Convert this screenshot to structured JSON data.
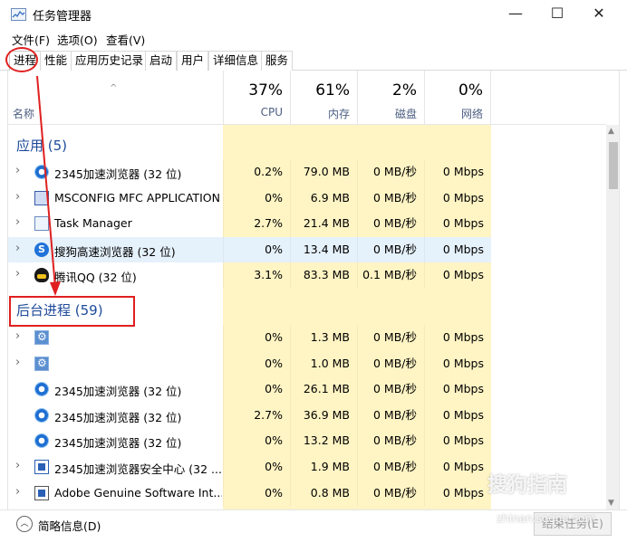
{
  "window": {
    "title": "任务管理器",
    "min": "—",
    "max": "☐",
    "close": "✕"
  },
  "menu": [
    "文件(F)",
    "选项(O)",
    "查看(V)"
  ],
  "tabs": [
    "进程",
    "性能",
    "应用历史记录",
    "启动",
    "用户",
    "详细信息",
    "服务"
  ],
  "header": {
    "name_label": "名称",
    "sort_caret": "^",
    "columns": [
      {
        "pct": "37%",
        "label": "CPU"
      },
      {
        "pct": "61%",
        "label": "内存"
      },
      {
        "pct": "2%",
        "label": "磁盘"
      },
      {
        "pct": "0%",
        "label": "网络"
      }
    ]
  },
  "groups": {
    "apps": "应用 (5)",
    "background": "后台进程 (59)"
  },
  "app_rows": [
    {
      "name": "2345加速浏览器 (32 位)",
      "icon": "globe-icon",
      "cpu": "0.2%",
      "mem": "79.0 MB",
      "disk": "0 MB/秒",
      "net": "0 Mbps"
    },
    {
      "name": "MSCONFIG MFC APPLICATION",
      "icon": "monitor-icon",
      "cpu": "0%",
      "mem": "6.9 MB",
      "disk": "0 MB/秒",
      "net": "0 Mbps"
    },
    {
      "name": "Task Manager",
      "icon": "task-manager-icon",
      "cpu": "2.7%",
      "mem": "21.4 MB",
      "disk": "0 MB/秒",
      "net": "0 Mbps"
    },
    {
      "name": "搜狗高速浏览器 (32 位)",
      "icon": "sogou-icon",
      "cpu": "0%",
      "mem": "13.4 MB",
      "disk": "0 MB/秒",
      "net": "0 Mbps"
    },
    {
      "name": "腾讯QQ (32 位)",
      "icon": "qq-icon",
      "cpu": "3.1%",
      "mem": "83.3 MB",
      "disk": "0.1 MB/秒",
      "net": "0 Mbps"
    }
  ],
  "bg_rows": [
    {
      "name": "",
      "icon": "gear-icon",
      "expander": true,
      "cpu": "0%",
      "mem": "1.3 MB",
      "disk": "0 MB/秒",
      "net": "0 Mbps"
    },
    {
      "name": "",
      "icon": "gear-icon",
      "expander": true,
      "cpu": "0%",
      "mem": "1.0 MB",
      "disk": "0 MB/秒",
      "net": "0 Mbps"
    },
    {
      "name": "2345加速浏览器 (32 位)",
      "icon": "globe-icon",
      "expander": false,
      "cpu": "0%",
      "mem": "26.1 MB",
      "disk": "0 MB/秒",
      "net": "0 Mbps"
    },
    {
      "name": "2345加速浏览器 (32 位)",
      "icon": "globe-icon",
      "expander": false,
      "cpu": "2.7%",
      "mem": "36.9 MB",
      "disk": "0 MB/秒",
      "net": "0 Mbps"
    },
    {
      "name": "2345加速浏览器 (32 位)",
      "icon": "globe-icon",
      "expander": false,
      "cpu": "0%",
      "mem": "13.2 MB",
      "disk": "0 MB/秒",
      "net": "0 Mbps"
    },
    {
      "name": "2345加速浏览器安全中心 (32 ...",
      "icon": "service-icon",
      "expander": true,
      "cpu": "0%",
      "mem": "1.9 MB",
      "disk": "0 MB/秒",
      "net": "0 Mbps"
    },
    {
      "name": "Adobe Genuine Software Int...",
      "icon": "adobe-icon",
      "expander": true,
      "cpu": "0%",
      "mem": "0.8 MB",
      "disk": "0 MB/秒",
      "net": "0 Mbps"
    }
  ],
  "footer": {
    "fewer_details": "简略信息(D)",
    "end_task": "结束任务(E)"
  },
  "watermark": {
    "main": "搜狗指南",
    "sub": "zhinan.sogou.com"
  },
  "colors": {
    "cpu_band": "#fff4c4",
    "group_title": "#1e4a9a",
    "annotation": "#e02020"
  }
}
